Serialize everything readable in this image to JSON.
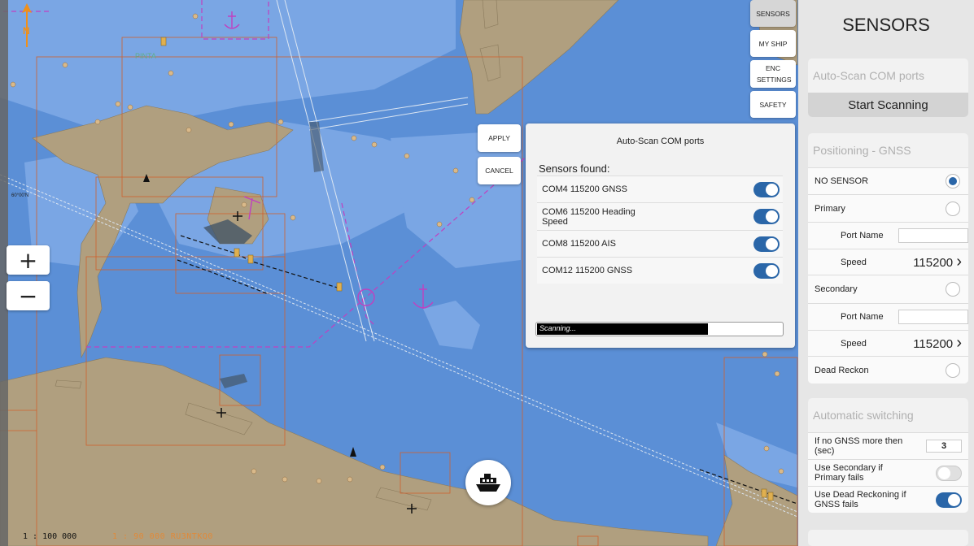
{
  "chart": {
    "scale_main": "1 : 100 000",
    "scale_cell": "1 : 90 000  RU3NTKQ0",
    "north_label": "N",
    "lat_label": "60°00'N",
    "pinta_label": "PINTA"
  },
  "zoom": {
    "in_label": "+",
    "out_label": "−"
  },
  "tabs": {
    "sensors": "SENSORS",
    "my_ship": "MY SHIP",
    "enc_settings": "ENC SETTINGS",
    "safety": "SAFETY"
  },
  "actions": {
    "apply": "APPLY",
    "cancel": "CANCEL"
  },
  "scan_dialog": {
    "title": "Auto-Scan COM ports",
    "found_label": "Sensors found:",
    "sensors": [
      {
        "label": "COM4 115200 GNSS",
        "enabled": true
      },
      {
        "label": "COM6 115200 Heading Speed",
        "enabled": true
      },
      {
        "label": "COM8 115200 AIS",
        "enabled": true
      },
      {
        "label": "COM12 115200 GNSS",
        "enabled": true
      }
    ],
    "progress_text": "Scanning...",
    "progress": 0.7
  },
  "panel": {
    "title": "SENSORS",
    "auto_scan": {
      "heading": "Auto-Scan COM ports",
      "button": "Start Scanning"
    },
    "positioning": {
      "heading": "Positioning - GNSS",
      "no_sensor": "NO SENSOR",
      "primary": "Primary",
      "secondary": "Secondary",
      "port_name": "Port Name",
      "speed": "Speed",
      "primary_speed": "115200",
      "secondary_speed": "115200",
      "dead_reckon": "Dead Reckon",
      "chevron": "›"
    },
    "switching": {
      "heading": "Automatic switching",
      "no_gnss_label": "If no GNSS more then (sec)",
      "no_gnss_value": "3",
      "use_secondary": "Use Secondary if Primary fails",
      "use_secondary_on": false,
      "use_dead_reckoning": "Use Dead Reckoning if GNSS fails",
      "use_dead_reckoning_on": true
    }
  },
  "colors": {
    "deep_water": "#5b8fd6",
    "shallow_water": "#7aa6e4",
    "land": "#b09f7f",
    "accent": "#2a66a8",
    "magenta": "#c040c0",
    "grid": "#d0602c"
  }
}
